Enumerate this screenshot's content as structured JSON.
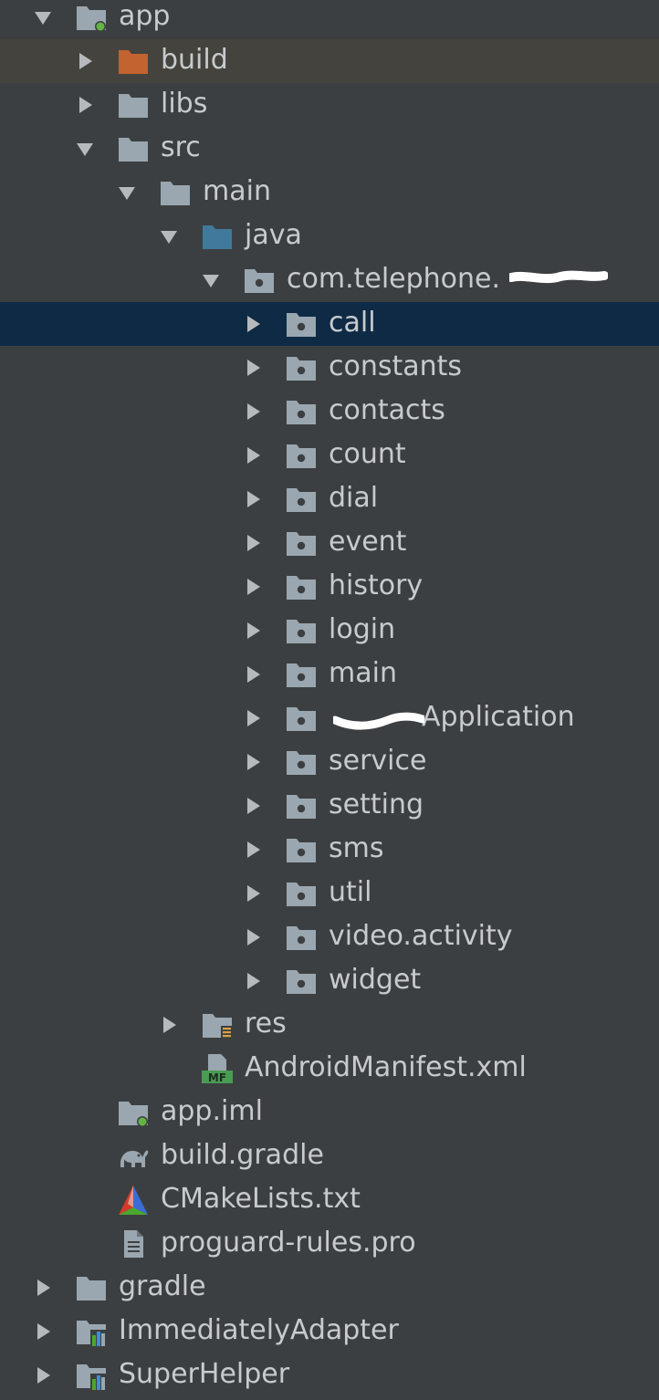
{
  "tree": {
    "items": [
      {
        "label": "app",
        "depth": 0,
        "arrow": "down",
        "icon": "module-folder-icon"
      },
      {
        "label": "build",
        "depth": 1,
        "arrow": "right",
        "icon": "excluded-folder-icon"
      },
      {
        "label": "libs",
        "depth": 1,
        "arrow": "right",
        "icon": "folder-icon"
      },
      {
        "label": "src",
        "depth": 1,
        "arrow": "down",
        "icon": "folder-icon"
      },
      {
        "label": "main",
        "depth": 2,
        "arrow": "down",
        "icon": "folder-icon"
      },
      {
        "label": "java",
        "depth": 3,
        "arrow": "down",
        "icon": "source-folder-icon"
      },
      {
        "label": "com.telephone.",
        "depth": 4,
        "arrow": "down",
        "icon": "package-icon",
        "redacted": true
      },
      {
        "label": "call",
        "depth": 5,
        "arrow": "right",
        "icon": "package-icon",
        "selected": true
      },
      {
        "label": "constants",
        "depth": 5,
        "arrow": "right",
        "icon": "package-icon"
      },
      {
        "label": "contacts",
        "depth": 5,
        "arrow": "right",
        "icon": "package-icon"
      },
      {
        "label": "count",
        "depth": 5,
        "arrow": "right",
        "icon": "package-icon"
      },
      {
        "label": "dial",
        "depth": 5,
        "arrow": "right",
        "icon": "package-icon"
      },
      {
        "label": "event",
        "depth": 5,
        "arrow": "right",
        "icon": "package-icon"
      },
      {
        "label": "history",
        "depth": 5,
        "arrow": "right",
        "icon": "package-icon"
      },
      {
        "label": "login",
        "depth": 5,
        "arrow": "right",
        "icon": "package-icon"
      },
      {
        "label": "main",
        "depth": 5,
        "arrow": "right",
        "icon": "package-icon"
      },
      {
        "label": "Application",
        "depth": 5,
        "arrow": "right",
        "icon": "package-icon",
        "redacted": true
      },
      {
        "label": "service",
        "depth": 5,
        "arrow": "right",
        "icon": "package-icon"
      },
      {
        "label": "setting",
        "depth": 5,
        "arrow": "right",
        "icon": "package-icon"
      },
      {
        "label": "sms",
        "depth": 5,
        "arrow": "right",
        "icon": "package-icon"
      },
      {
        "label": "util",
        "depth": 5,
        "arrow": "right",
        "icon": "package-icon"
      },
      {
        "label": "video.activity",
        "depth": 5,
        "arrow": "right",
        "icon": "package-icon"
      },
      {
        "label": "widget",
        "depth": 5,
        "arrow": "right",
        "icon": "package-icon"
      },
      {
        "label": "res",
        "depth": 3,
        "arrow": "right",
        "icon": "resource-folder-icon"
      },
      {
        "label": "AndroidManifest.xml",
        "depth": 3,
        "arrow": "none",
        "icon": "manifest-icon"
      },
      {
        "label": "app.iml",
        "depth": 1,
        "arrow": "none",
        "icon": "iml-file-icon"
      },
      {
        "label": "build.gradle",
        "depth": 1,
        "arrow": "none",
        "icon": "gradle-icon"
      },
      {
        "label": "CMakeLists.txt",
        "depth": 1,
        "arrow": "none",
        "icon": "cmake-icon"
      },
      {
        "label": "proguard-rules.pro",
        "depth": 1,
        "arrow": "none",
        "icon": "text-file-icon"
      },
      {
        "label": "gradle",
        "depth": 0,
        "arrow": "right",
        "icon": "folder-icon"
      },
      {
        "label": "ImmediatelyAdapter",
        "depth": 0,
        "arrow": "right",
        "icon": "library-module-icon"
      },
      {
        "label": "SuperHelper",
        "depth": 0,
        "arrow": "right",
        "icon": "library-module-icon"
      }
    ]
  },
  "colors": {
    "background": "#3c3f41",
    "text": "#c8cbcd",
    "folder": "#9aa7b0",
    "excluded_folder": "#c3632f",
    "source_folder": "#40799b",
    "selection": "#0e2a45"
  }
}
